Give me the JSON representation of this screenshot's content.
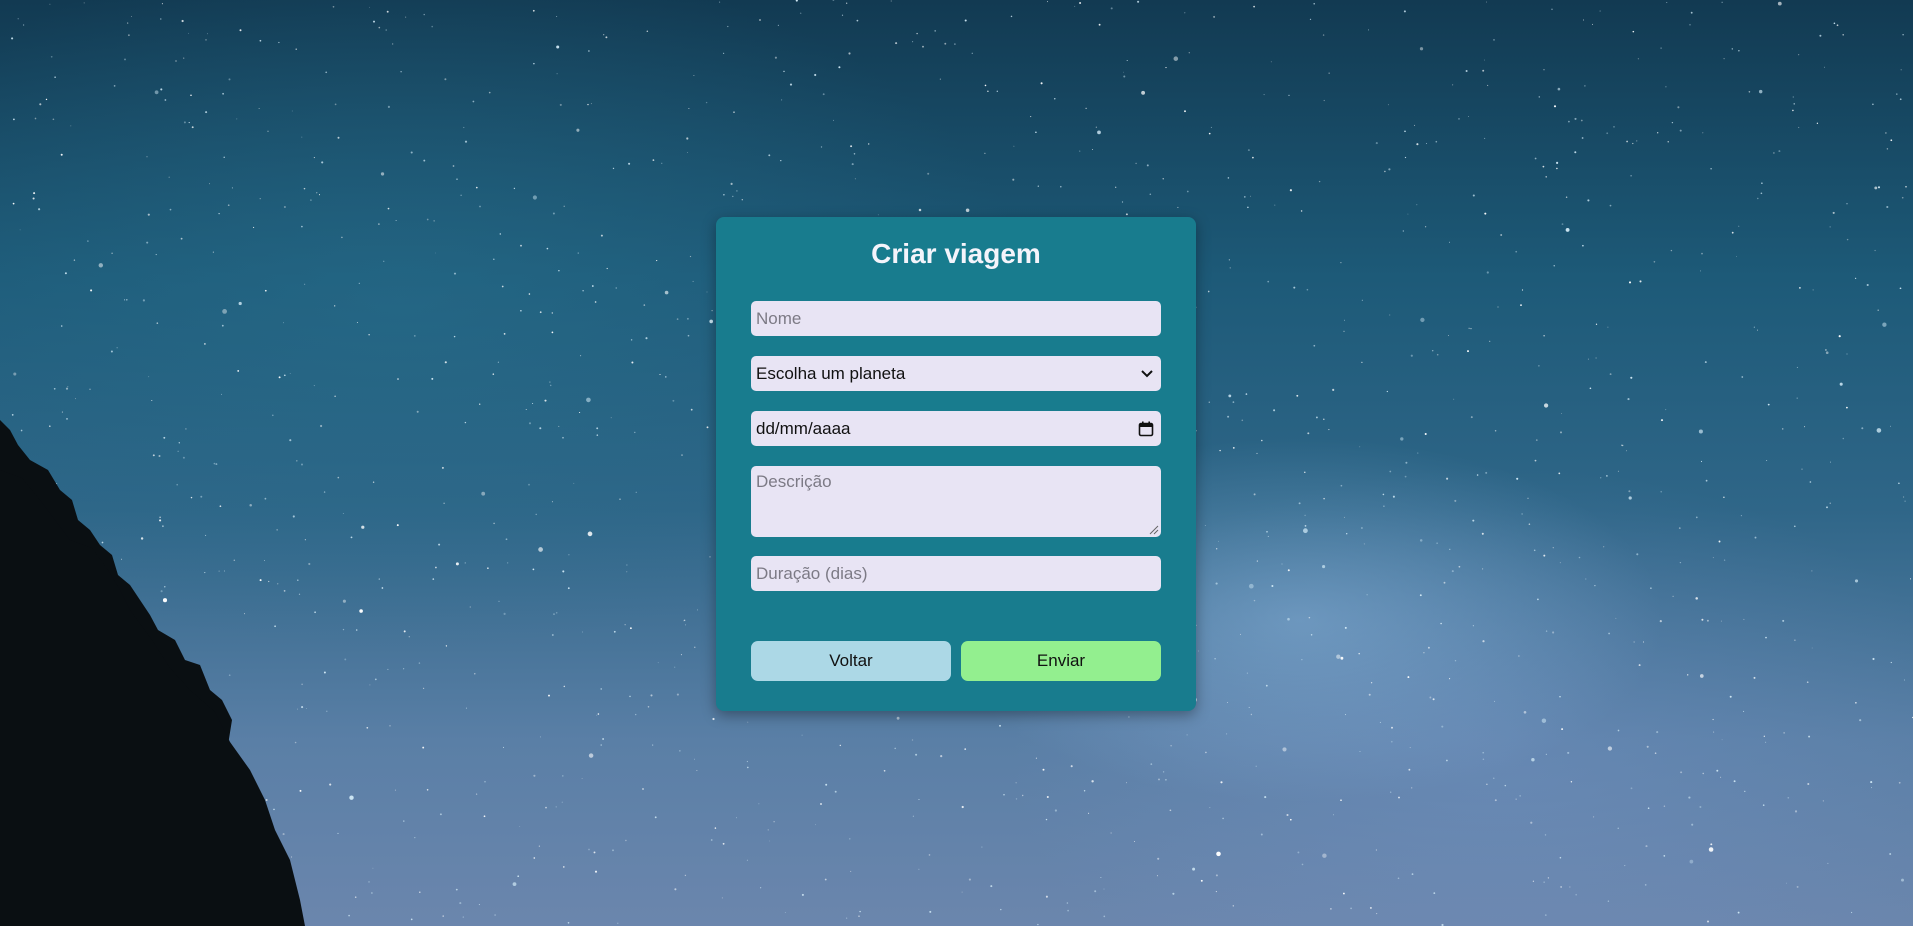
{
  "form": {
    "title": "Criar viagem",
    "name_placeholder": "Nome",
    "planet_select": {
      "selected": "Escolha um planeta",
      "icon": "chevron-down-icon"
    },
    "date_field": {
      "value": "dd/mm/aaaa",
      "icon": "calendar-icon"
    },
    "description_placeholder": "Descrição",
    "duration_placeholder": "Duração (dias)",
    "back_label": "Voltar",
    "submit_label": "Enviar"
  },
  "colors": {
    "card": "#187c8e",
    "field": "#e8e4f4",
    "back_button": "#acd8e6",
    "submit_button": "#93ef8f",
    "title_text": "#f4f4fb"
  }
}
